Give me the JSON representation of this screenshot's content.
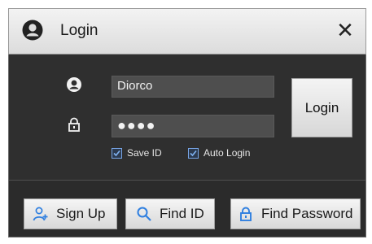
{
  "window": {
    "title": "Login",
    "close_label": "✕"
  },
  "form": {
    "username_value": "Diorco",
    "password_value": "●●●●",
    "login_label": "Login",
    "save_id_label": "Save ID",
    "save_id_checked": true,
    "auto_login_label": "Auto Login",
    "auto_login_checked": true
  },
  "footer": {
    "sign_up_label": "Sign Up",
    "find_id_label": "Find ID",
    "find_password_label": "Find Password"
  },
  "icons": {
    "title": "user-circle-icon",
    "username": "user-circle-icon",
    "password": "lock-icon",
    "sign_up": "add-user-icon",
    "find_id": "search-icon",
    "find_password": "lock-icon"
  },
  "colors": {
    "accent": "#2f7fe0",
    "panel_bg": "#2f2f2f",
    "field_bg": "#4e4e4e"
  }
}
